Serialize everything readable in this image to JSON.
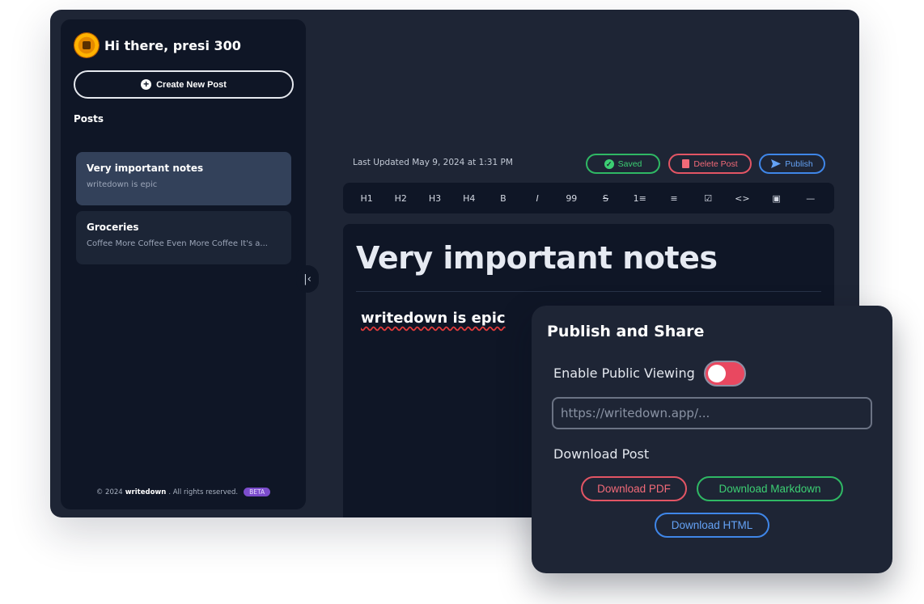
{
  "sidebar": {
    "greeting": "Hi there, presi 300",
    "create_label": "Create New Post",
    "posts_heading": "Posts",
    "posts": [
      {
        "title": "Very important notes",
        "snippet": "writedown is epic"
      },
      {
        "title": "Groceries",
        "snippet": "Coffee More Coffee Even More Coffee It's a..."
      }
    ],
    "footer": {
      "prefix": "© 2024",
      "brand": "writedown",
      "suffix": ". All rights reserved.",
      "badge": "BETA"
    },
    "collapse_glyph": "|‹"
  },
  "editor": {
    "last_updated": "Last Updated May 9, 2024 at 1:31 PM",
    "saved_label": "Saved",
    "delete_label": "Delete Post",
    "publish_label": "Publish",
    "toolbar": [
      "H1",
      "H2",
      "H3",
      "H4",
      "B",
      "I",
      "99",
      "S",
      "1≡",
      "≡",
      "☑",
      "<>",
      "▣",
      "—"
    ],
    "doc_title": "Very important notes",
    "doc_body": "writedown is epic"
  },
  "share_panel": {
    "title": "Publish and Share",
    "public_label": "Enable Public Viewing",
    "public_enabled": true,
    "url_placeholder": "https://writedown.app/...",
    "download_heading": "Download Post",
    "download_pdf": "Download PDF",
    "download_markdown": "Download Markdown",
    "download_html": "Download HTML"
  },
  "colors": {
    "background": "#1e2535",
    "panel": "#0f1626",
    "green": "#3ccf73",
    "red": "#f26a78",
    "blue": "#64a2f5",
    "beta": "#7c4dcc"
  }
}
